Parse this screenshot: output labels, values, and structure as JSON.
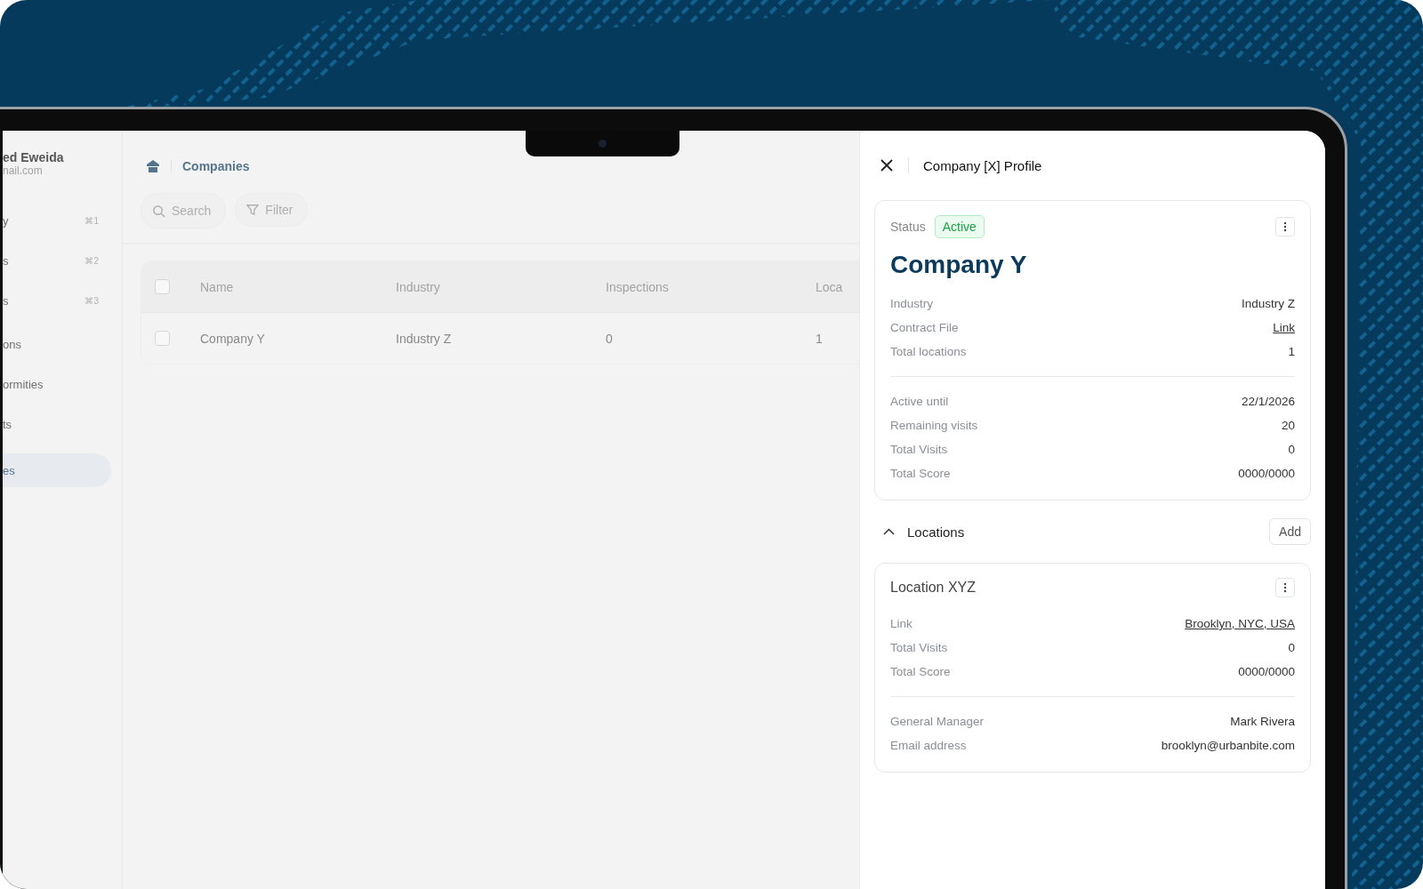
{
  "sidebar": {
    "user_name": "ed Eweida",
    "user_email": "nail.com",
    "items": [
      {
        "label": "y",
        "shortcut": "⌘1",
        "selected": false
      },
      {
        "label": "s",
        "shortcut": "⌘2",
        "selected": false
      },
      {
        "label": "s",
        "shortcut": "⌘3",
        "selected": false
      },
      {
        "label": "ons",
        "selected": false
      },
      {
        "label": "ormities",
        "selected": false
      },
      {
        "label": "ts",
        "selected": false
      },
      {
        "label": "es",
        "selected": true
      }
    ]
  },
  "main": {
    "breadcrumb": "Companies",
    "search": {
      "placeholder": "Search"
    },
    "filter_button": "Filter",
    "table": {
      "header_checked": false,
      "columns": [
        "Name",
        "Industry",
        "Inspections",
        "Loca"
      ],
      "rows": [
        {
          "checked": false,
          "cells": [
            "Company Y",
            "Industry Z",
            "0",
            "1"
          ]
        }
      ]
    }
  },
  "panel": {
    "title": "Company [X] Profile",
    "status_label": "Status",
    "status": "Active",
    "company_name": "Company Y",
    "groups": [
      [
        {
          "label": "Industry",
          "value": "Industry Z",
          "kind": "text"
        },
        {
          "label": "Contract File",
          "value": "Link",
          "kind": "link"
        },
        {
          "label": "Total locations",
          "value": "1",
          "kind": "text"
        }
      ],
      [
        {
          "label": "Active until",
          "value": "22/1/2026",
          "kind": "text"
        },
        {
          "label": "Remaining visits",
          "value": "20",
          "kind": "text"
        },
        {
          "label": "Total Visits",
          "value": "0",
          "kind": "text"
        },
        {
          "label": "Total Score",
          "value": "0000/0000",
          "kind": "text"
        }
      ]
    ],
    "locations": {
      "title": "Locations",
      "expanded": true,
      "add_button": "Add",
      "items": [
        {
          "name": "Location XYZ",
          "groups": [
            [
              {
                "label": "Link",
                "value": "Brooklyn, NYC, USA",
                "kind": "link"
              },
              {
                "label": "Total Visits",
                "value": "0",
                "kind": "text"
              },
              {
                "label": "Total Score",
                "value": "0000/0000",
                "kind": "text"
              }
            ],
            [
              {
                "label": "General Manager",
                "value": "Mark Rivera",
                "kind": "text"
              },
              {
                "label": "Email address",
                "value": "brooklyn@urbanbite.com",
                "kind": "text"
              }
            ]
          ]
        }
      ]
    }
  }
}
